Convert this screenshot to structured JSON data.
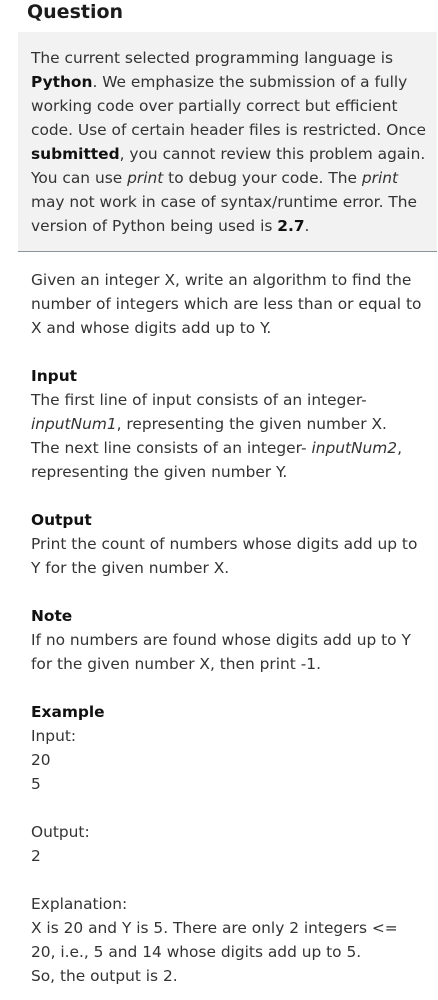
{
  "header": {
    "title": "Question"
  },
  "notice": {
    "p1_a": "The current selected programming language is ",
    "p1_lang": "Python",
    "p1_b": ". We emphasize the submission of a fully working code over partially correct but efficient code. Use of certain header files is restricted. Once ",
    "p1_submitted": "submitted",
    "p1_c": ", you cannot review this problem again. You can use ",
    "p1_print1": "print",
    "p1_d": " to debug your code. The ",
    "p1_print2": "print",
    "p1_e": " may not work in case of syntax/runtime error. The version of Python being used is ",
    "p1_version": "2.7",
    "p1_f": "."
  },
  "problem": {
    "statement": "Given an integer X, write an algorithm to find the number of integers which are less than or equal to X and whose digits add up to Y.",
    "input_title": "Input",
    "input_a": "The first line of input consists of an integer- ",
    "input_var1": "inputNum1",
    "input_b": ", representing the given number X.",
    "input_c": "The next line consists of an integer- ",
    "input_var2": "inputNum2",
    "input_d": ", representing the given number Y.",
    "output_title": "Output",
    "output_text": "Print the count of numbers whose digits add up to Y for the given number X.",
    "note_title": "Note",
    "note_text": "If no numbers are found whose digits add up to Y for the given number X, then print -1.",
    "example_title": "Example",
    "example_input_label": "Input:",
    "example_input_1": "20",
    "example_input_2": "5",
    "example_output_label": "Output:",
    "example_output_1": "2",
    "explanation_label": "Explanation:",
    "explanation_1": "X is 20 and Y is 5. There are only 2 integers <= 20, i.e., 5 and 14 whose digits add up to 5.",
    "explanation_2": "So, the output is 2."
  }
}
